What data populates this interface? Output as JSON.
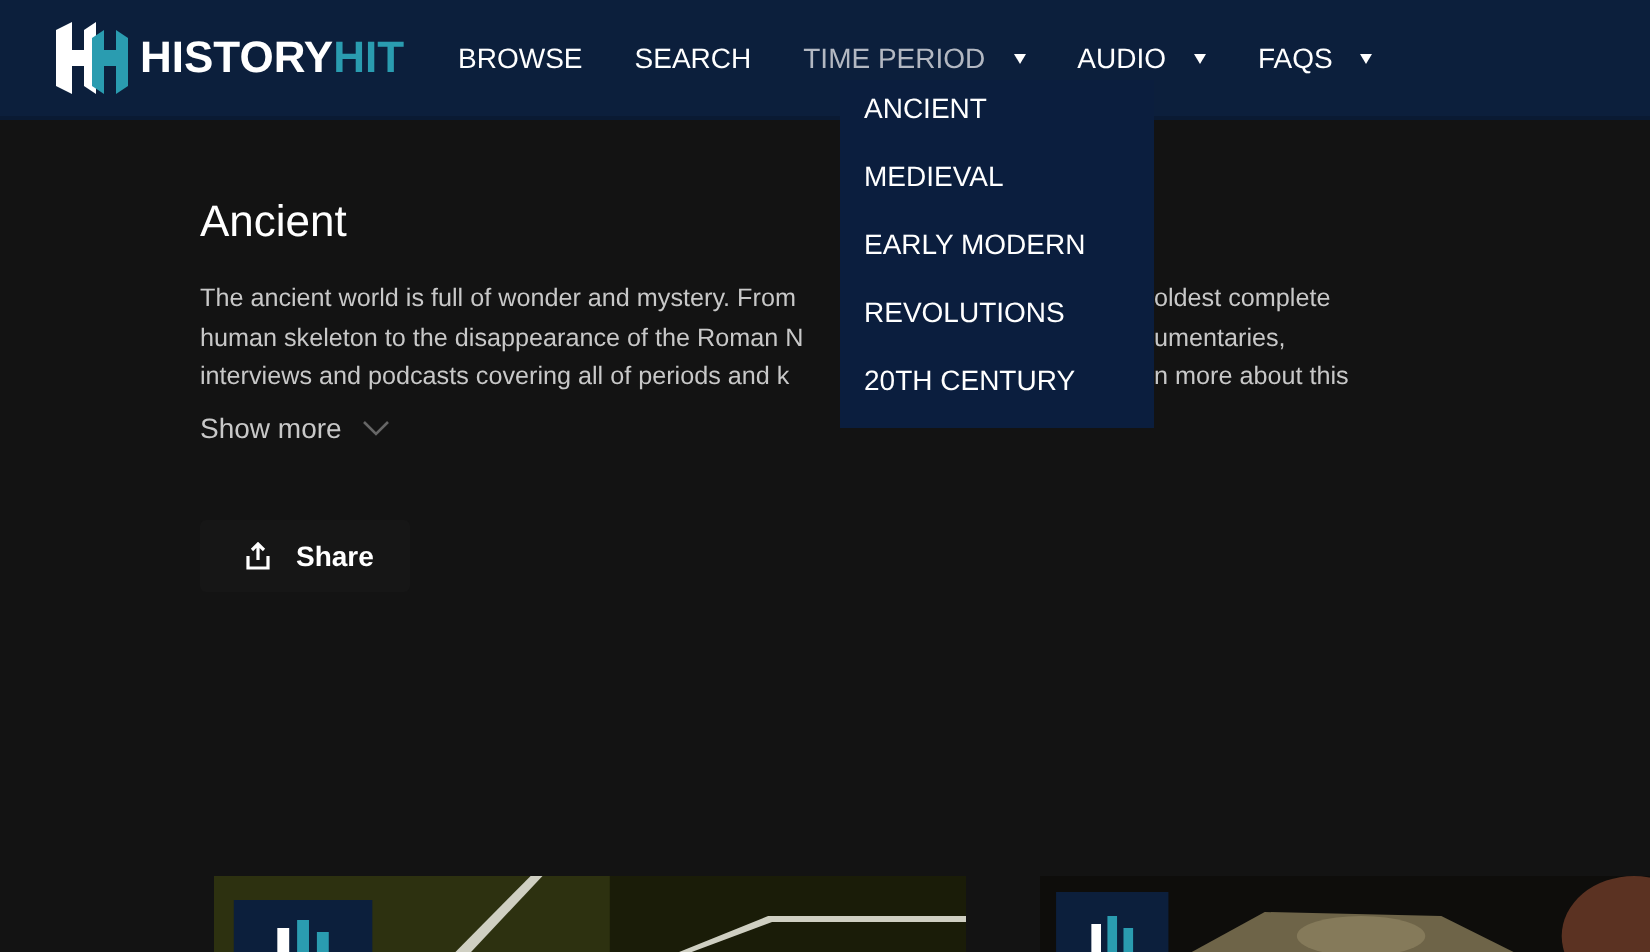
{
  "header": {
    "logo": {
      "word_1": "HISTORY",
      "word_2": "HIT"
    },
    "nav": [
      {
        "label": "BROWSE",
        "has_dropdown": false,
        "selected": false
      },
      {
        "label": "SEARCH",
        "has_dropdown": false,
        "selected": false
      },
      {
        "label": "TIME PERIOD",
        "has_dropdown": true,
        "selected": true
      },
      {
        "label": "AUDIO",
        "has_dropdown": true,
        "selected": false
      },
      {
        "label": "FAQS",
        "has_dropdown": true,
        "selected": false
      }
    ],
    "dropdown": {
      "items": [
        "ANCIENT",
        "MEDIEVAL",
        "EARLY MODERN",
        "REVOLUTIONS",
        "20TH CENTURY"
      ]
    }
  },
  "page": {
    "title": "Ancient",
    "description_lines": [
      {
        "left": "The ancient world is full of wonder and mystery. From",
        "right": "oldest complete"
      },
      {
        "left": "human skeleton to the disappearance of the Roman N",
        "right": "umentaries,"
      },
      {
        "left": "interviews and podcasts covering all of periods and k",
        "right": "n more about this"
      }
    ],
    "show_more": "Show more",
    "share": "Share"
  }
}
